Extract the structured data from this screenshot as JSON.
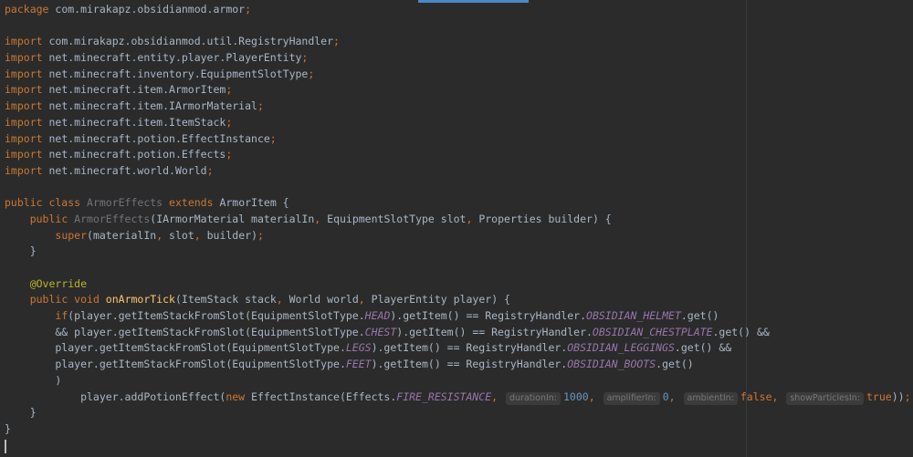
{
  "editor": {
    "lines": [
      [
        {
          "t": "package",
          "c": "k"
        },
        {
          "t": " com.mirakapz.obsidianmod.armor",
          "c": ""
        },
        {
          "t": ";",
          "c": "k"
        }
      ],
      [],
      [
        {
          "t": "import",
          "c": "k"
        },
        {
          "t": " com.mirakapz.obsidianmod.util.RegistryHandler",
          "c": ""
        },
        {
          "t": ";",
          "c": "k"
        }
      ],
      [
        {
          "t": "import",
          "c": "k"
        },
        {
          "t": " net.minecraft.entity.player.PlayerEntity",
          "c": ""
        },
        {
          "t": ";",
          "c": "k"
        }
      ],
      [
        {
          "t": "import",
          "c": "k"
        },
        {
          "t": " net.minecraft.inventory.EquipmentSlotType",
          "c": ""
        },
        {
          "t": ";",
          "c": "k"
        }
      ],
      [
        {
          "t": "import",
          "c": "k"
        },
        {
          "t": " net.minecraft.item.ArmorItem",
          "c": ""
        },
        {
          "t": ";",
          "c": "k"
        }
      ],
      [
        {
          "t": "import",
          "c": "k"
        },
        {
          "t": " net.minecraft.item.IArmorMaterial",
          "c": ""
        },
        {
          "t": ";",
          "c": "k"
        }
      ],
      [
        {
          "t": "import",
          "c": "k"
        },
        {
          "t": " net.minecraft.item.ItemStack",
          "c": ""
        },
        {
          "t": ";",
          "c": "k"
        }
      ],
      [
        {
          "t": "import",
          "c": "k"
        },
        {
          "t": " net.minecraft.potion.EffectInstance",
          "c": ""
        },
        {
          "t": ";",
          "c": "k"
        }
      ],
      [
        {
          "t": "import",
          "c": "k"
        },
        {
          "t": " net.minecraft.potion.Effects",
          "c": ""
        },
        {
          "t": ";",
          "c": "k"
        }
      ],
      [
        {
          "t": "import",
          "c": "k"
        },
        {
          "t": " net.minecraft.world.World",
          "c": ""
        },
        {
          "t": ";",
          "c": "k"
        }
      ],
      [],
      [
        {
          "t": "public class ",
          "c": "k"
        },
        {
          "t": "ArmorEffects",
          "c": "unused"
        },
        {
          "t": " ",
          "c": ""
        },
        {
          "t": "extends ",
          "c": "k"
        },
        {
          "t": "ArmorItem {",
          "c": ""
        }
      ],
      [
        {
          "t": "    ",
          "c": ""
        },
        {
          "t": "public ",
          "c": "k"
        },
        {
          "t": "ArmorEffects",
          "c": "unused"
        },
        {
          "t": "(IArmorMaterial materialIn",
          "c": ""
        },
        {
          "t": ", ",
          "c": "k"
        },
        {
          "t": "EquipmentSlotType slot",
          "c": ""
        },
        {
          "t": ", ",
          "c": "k"
        },
        {
          "t": "Properties builder) {",
          "c": ""
        }
      ],
      [
        {
          "t": "        ",
          "c": ""
        },
        {
          "t": "super",
          "c": "k"
        },
        {
          "t": "(materialIn",
          "c": ""
        },
        {
          "t": ", ",
          "c": "k"
        },
        {
          "t": "slot",
          "c": ""
        },
        {
          "t": ", ",
          "c": "k"
        },
        {
          "t": "builder)",
          "c": ""
        },
        {
          "t": ";",
          "c": "k"
        }
      ],
      [
        {
          "t": "    }",
          "c": ""
        }
      ],
      [],
      [
        {
          "t": "    ",
          "c": ""
        },
        {
          "t": "@Override",
          "c": "ann"
        }
      ],
      [
        {
          "t": "    ",
          "c": ""
        },
        {
          "t": "public void ",
          "c": "k"
        },
        {
          "t": "onArmorTick",
          "c": "fn"
        },
        {
          "t": "(ItemStack stack",
          "c": ""
        },
        {
          "t": ", ",
          "c": "k"
        },
        {
          "t": "World world",
          "c": ""
        },
        {
          "t": ", ",
          "c": "k"
        },
        {
          "t": "PlayerEntity player) {",
          "c": ""
        }
      ],
      [
        {
          "t": "        ",
          "c": ""
        },
        {
          "t": "if",
          "c": "k"
        },
        {
          "t": "(player.getItemStackFromSlot(EquipmentSlotType.",
          "c": ""
        },
        {
          "t": "HEAD",
          "c": "const"
        },
        {
          "t": ").getItem() == RegistryHandler.",
          "c": ""
        },
        {
          "t": "OBSIDIAN_HELMET",
          "c": "const"
        },
        {
          "t": ".get()",
          "c": ""
        }
      ],
      [
        {
          "t": "        && player.getItemStackFromSlot(EquipmentSlotType.",
          "c": ""
        },
        {
          "t": "CHEST",
          "c": "const"
        },
        {
          "t": ").getItem() == RegistryHandler.",
          "c": ""
        },
        {
          "t": "OBSIDIAN_CHESTPLATE",
          "c": "const"
        },
        {
          "t": ".get() &&",
          "c": ""
        }
      ],
      [
        {
          "t": "        player.getItemStackFromSlot(EquipmentSlotType.",
          "c": ""
        },
        {
          "t": "LEGS",
          "c": "const"
        },
        {
          "t": ").getItem() == RegistryHandler.",
          "c": ""
        },
        {
          "t": "OBSIDIAN_LEGGINGS",
          "c": "const"
        },
        {
          "t": ".get() &&",
          "c": ""
        }
      ],
      [
        {
          "t": "        player.getItemStackFromSlot(EquipmentSlotType.",
          "c": ""
        },
        {
          "t": "FEET",
          "c": "const"
        },
        {
          "t": ").getItem() == RegistryHandler.",
          "c": ""
        },
        {
          "t": "OBSIDIAN_BOOTS",
          "c": "const"
        },
        {
          "t": ".get()",
          "c": ""
        }
      ],
      [
        {
          "t": "        )",
          "c": ""
        }
      ],
      [
        {
          "t": "            player.addPotionEffect(",
          "c": ""
        },
        {
          "t": "new ",
          "c": "k"
        },
        {
          "t": "EffectInstance(Effects.",
          "c": ""
        },
        {
          "t": "FIRE_RESISTANCE",
          "c": "const"
        },
        {
          "t": ", ",
          "c": "k"
        },
        {
          "t": "durationIn:",
          "c": "hint"
        },
        {
          "t": "1000",
          "c": "num"
        },
        {
          "t": ", ",
          "c": "k"
        },
        {
          "t": "amplifierIn:",
          "c": "hint"
        },
        {
          "t": "0",
          "c": "num"
        },
        {
          "t": ", ",
          "c": "k"
        },
        {
          "t": "ambientIn:",
          "c": "hint"
        },
        {
          "t": "false",
          "c": "k"
        },
        {
          "t": ", ",
          "c": "k"
        },
        {
          "t": "showParticlesIn:",
          "c": "hint"
        },
        {
          "t": "true",
          "c": "k"
        },
        {
          "t": "))",
          "c": ""
        },
        {
          "t": ";",
          "c": "k"
        }
      ],
      [
        {
          "t": "    }",
          "c": ""
        }
      ],
      [
        {
          "t": "}",
          "c": ""
        }
      ]
    ],
    "fold_marker_lines": [
      2,
      10,
      12,
      13,
      15,
      18,
      24,
      26
    ]
  }
}
